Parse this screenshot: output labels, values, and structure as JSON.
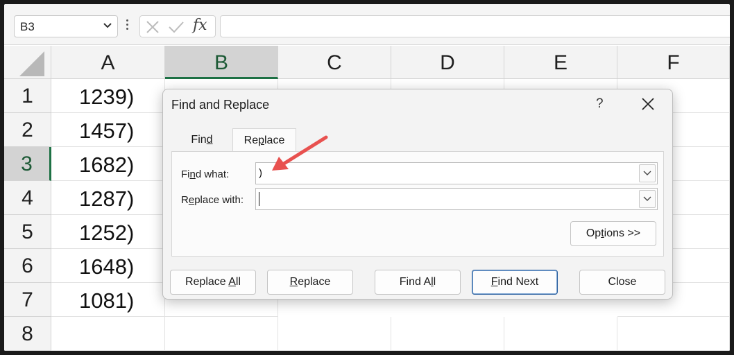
{
  "formula_bar": {
    "name_box": "B3",
    "formula": "",
    "fx_label": "fx"
  },
  "grid": {
    "columns": [
      "A",
      "B",
      "C",
      "D",
      "E",
      "F"
    ],
    "selected_column": "B",
    "rows": [
      "1",
      "2",
      "3",
      "4",
      "5",
      "6",
      "7",
      "8"
    ],
    "selected_row": "3",
    "column_a_values": [
      "1239)",
      "1457)",
      "1682)",
      "1287)",
      "1252)",
      "1648)",
      "1081)",
      ""
    ]
  },
  "dialog": {
    "title": "Find and Replace",
    "help": "?",
    "tabs": [
      {
        "label_pre": "Fin",
        "label_key": "d",
        "label_post": ""
      },
      {
        "label_pre": "Re",
        "label_key": "p",
        "label_post": "lace"
      }
    ],
    "find_what_label": {
      "pre": "Fi",
      "key": "n",
      "post": "d what:"
    },
    "find_what_value": ")",
    "replace_with_label": {
      "pre": "R",
      "key": "e",
      "post": "place with:"
    },
    "replace_with_value": "",
    "options_button": {
      "pre": "Op",
      "key": "t",
      "post": "ions >>"
    },
    "buttons": {
      "replace_all": {
        "pre": "Replace ",
        "key": "A",
        "post": "ll"
      },
      "replace": {
        "pre": "",
        "key": "R",
        "post": "eplace"
      },
      "find_all": {
        "pre": "Find A",
        "key": "l",
        "post": "l"
      },
      "find_next": {
        "pre": "",
        "key": "F",
        "post": "ind Next"
      },
      "close": "Close"
    }
  },
  "colors": {
    "selection_green": "#1e7145",
    "arrow_red": "#e8514f",
    "default_button_border": "#2a5f9e"
  }
}
